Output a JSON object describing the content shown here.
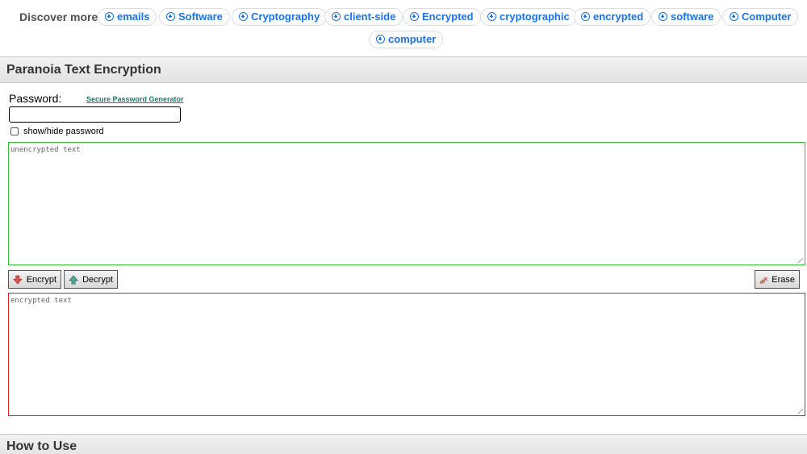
{
  "discover": {
    "label": "Discover more",
    "chips": [
      "emails",
      "Software",
      "Cryptography",
      "client-side",
      "Encrypted",
      "cryptographic",
      "encrypted",
      "software",
      "Computer",
      "computer"
    ]
  },
  "app": {
    "title": "Paranoia Text Encryption",
    "password_label": "Password:",
    "password_generator_link": "Secure Password Generator",
    "password_value": "",
    "show_hide_label": "show/hide password",
    "show_hide_checked": false,
    "plaintext_placeholder": "unencrypted text",
    "encrypted_placeholder": "encrypted text",
    "encrypt_label": "Encrypt",
    "decrypt_label": "Decrypt",
    "erase_label": "Erase"
  },
  "how_to_use": {
    "title": "How to Use"
  },
  "colors": {
    "chip_text": "#1a73e8",
    "plain_border": "#2fbf2f",
    "encrypted_border": "#e02020",
    "link": "#1f7a70"
  },
  "icons": {
    "chip": "plus-circle-icon",
    "encrypt": "arrow-down-icon",
    "decrypt": "arrow-up-icon",
    "erase": "eraser-icon"
  }
}
